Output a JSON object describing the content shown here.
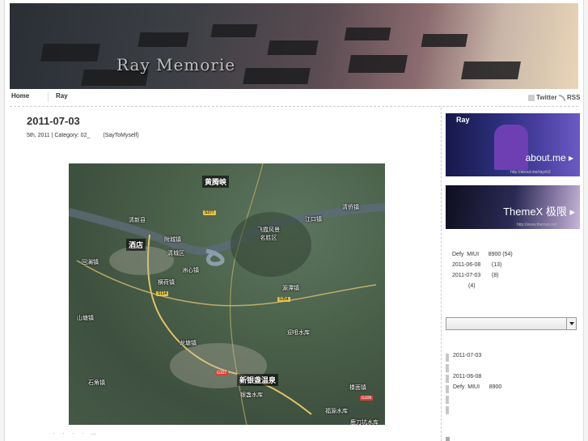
{
  "header": {
    "site_title": "Ray Memorie"
  },
  "nav": {
    "items": [
      {
        "label": "Home"
      },
      {
        "label": "Ray"
      }
    ],
    "social": {
      "twitter": "Twitter",
      "rss": "RSS"
    }
  },
  "post": {
    "title": "2011-07-03",
    "meta_date": "5th, 2011 | Category: 02_",
    "meta_category": "(SayToMyself)",
    "tail_text": "· · · · …"
  },
  "map": {
    "labels": [
      "黄腾峡",
      "清新县",
      "酒店",
      "清远市",
      "江口镇",
      "清侨镇",
      "飞霞风景名胜区",
      "附城镇",
      "清城区",
      "洲心镇",
      "横荷镇",
      "回澜镇",
      "源潭镇",
      "山塘镇",
      "迎咀水库",
      "龙塘镇",
      "石角镇",
      "新银盏温泉",
      "银盏水库",
      "楼面镇",
      "福源水库",
      "鹿刀坑水库"
    ],
    "shields": [
      "S377",
      "S114",
      "S354",
      "G107",
      "G106"
    ]
  },
  "sidebar": {
    "about_badge": {
      "name": "Ray",
      "cta": "about.me ▸",
      "url": "http://about.me/raych2"
    },
    "theme_badge": {
      "cta": "ThemeX 极限 ▸",
      "url": "http://www.themex.net"
    },
    "recent": [
      {
        "text": "Defy  MIUI      8900 (54)"
      },
      {
        "text": "2011-06-08       (13)"
      },
      {
        "text": "2011-07-03       (8)"
      },
      {
        "text": "(4)"
      }
    ],
    "select_value": "",
    "archive": [
      {
        "text": "2011-07-03"
      },
      {
        "text": ""
      },
      {
        "text": "2011-06-08"
      },
      {
        "text": "Defy  MIUI      8900"
      },
      {
        "text": ""
      },
      {
        "text": ""
      }
    ]
  }
}
